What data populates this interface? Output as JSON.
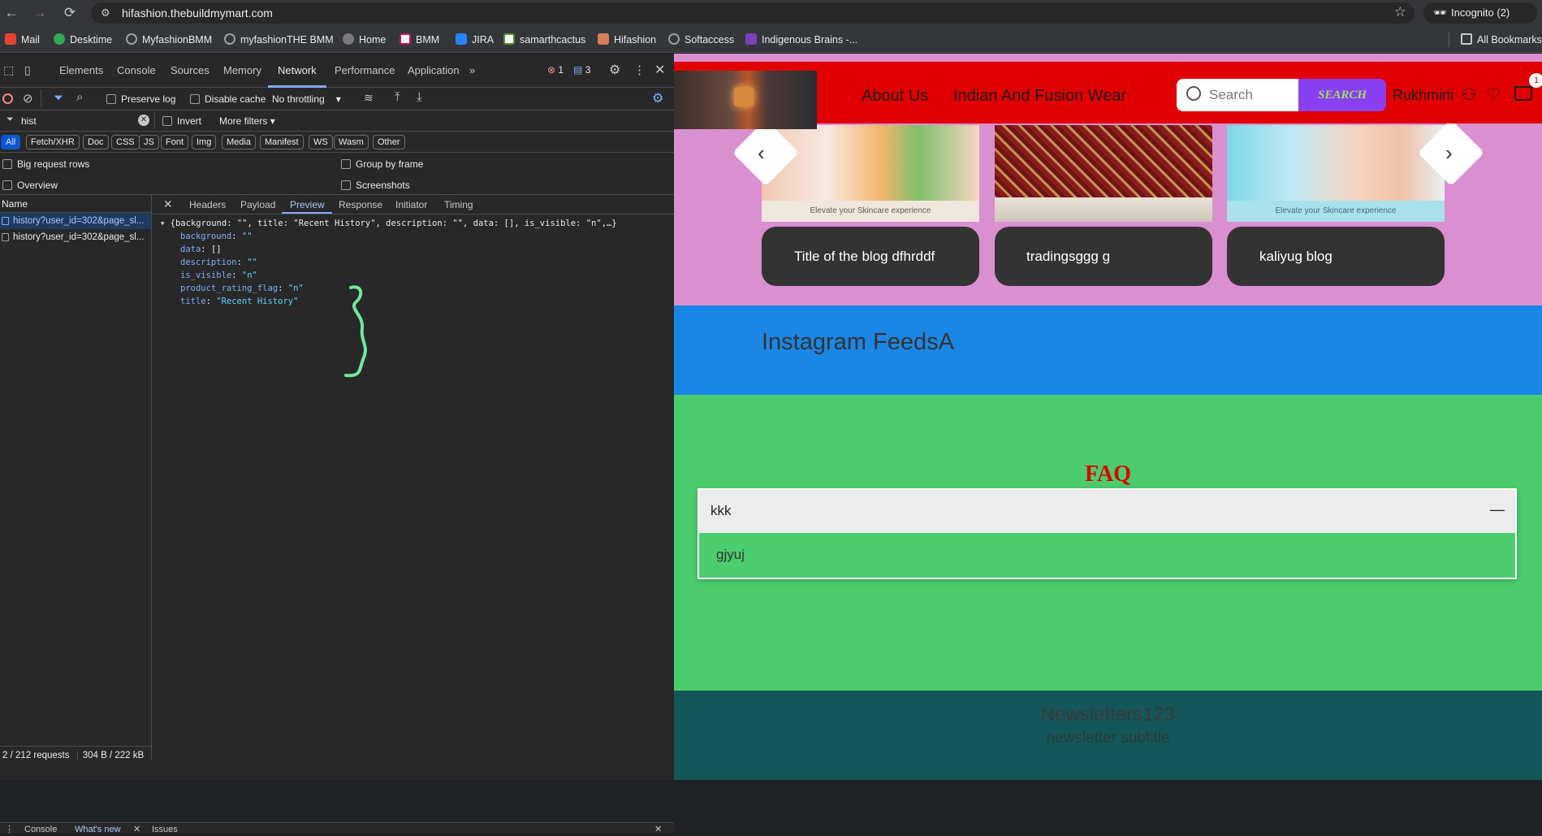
{
  "browser": {
    "url": "hifashion.thebuildmymart.com",
    "incognito_label": "Incognito (2)",
    "bookmarks": [
      "Mail",
      "Desktime",
      "MyfashionBMM",
      "myfashionTHE BMM",
      "Home",
      "BMM",
      "JIRA",
      "samarthcactus",
      "Hifashion",
      "Softaccess",
      "Indigenous Brains -..."
    ],
    "all_bookmarks": "All Bookmarks"
  },
  "devtools": {
    "tabs": [
      "Elements",
      "Console",
      "Sources",
      "Memory",
      "Network",
      "Performance",
      "Application"
    ],
    "error_count": "1",
    "message_count": "3",
    "toolbar": {
      "preserve_log": "Preserve log",
      "disable_cache": "Disable cache",
      "throttling": "No throttling"
    },
    "filter": {
      "value": "hist",
      "invert": "Invert",
      "more_filters": "More filters"
    },
    "types": [
      "All",
      "Fetch/XHR",
      "Doc",
      "CSS",
      "JS",
      "Font",
      "Img",
      "Media",
      "Manifest",
      "WS",
      "Wasm",
      "Other"
    ],
    "options": {
      "big_rows": "Big request rows",
      "overview": "Overview",
      "group_by_frame": "Group by frame",
      "screenshots": "Screenshots"
    },
    "name_header": "Name",
    "requests": [
      "history?user_id=302&page_sl...",
      "history?user_id=302&page_sl..."
    ],
    "status": {
      "requests": "2 / 212 requests",
      "size": "304 B / 222 kB"
    },
    "preview_tabs": [
      "Headers",
      "Payload",
      "Preview",
      "Response",
      "Initiator",
      "Timing"
    ],
    "preview": {
      "summary": "{background: \"\", title: \"Recent History\", description: \"\", data: [], is_visible: \"n\",…}",
      "fields": [
        {
          "key": "background",
          "value": "\"\""
        },
        {
          "key": "data",
          "value": "[]"
        },
        {
          "key": "description",
          "value": "\"\""
        },
        {
          "key": "is_visible",
          "value": "\"n\""
        },
        {
          "key": "product_rating_flag",
          "value": "\"n\""
        },
        {
          "key": "title",
          "value": "\"Recent History\""
        }
      ]
    },
    "drawer_tabs": [
      "Console",
      "What's new",
      "Issues"
    ]
  },
  "site": {
    "nav": [
      "About Us",
      "Indian And Fusion Wear"
    ],
    "search_placeholder": "Search",
    "search_button": "SEARCH",
    "user_name": "Rukhmini",
    "cart_count": "1",
    "blogs": [
      {
        "title": "Title of the blog dfhrddf",
        "image_caption": "Elevate your Skincare experience"
      },
      {
        "title": "tradingsggg g",
        "image_caption": ""
      },
      {
        "title": "kaliyug blog",
        "image_caption": "Elevate your Skincare experience"
      }
    ],
    "instagram_title": "Instagram FeedsA",
    "faq_title": "FAQ",
    "faq_question": "kkk",
    "faq_answer": "gjyuj",
    "faq_toggle": "—",
    "newsletter_title": "Newsletters123",
    "newsletter_subtitle": "newsletter subtitle"
  },
  "colors": {
    "header": "#e00000",
    "blog_bg": "#da8fd0",
    "insta_bg": "#1a86e6",
    "faq_bg": "#4bcd6e",
    "news_bg": "#14575a",
    "search_btn": "#8a3ff2"
  }
}
